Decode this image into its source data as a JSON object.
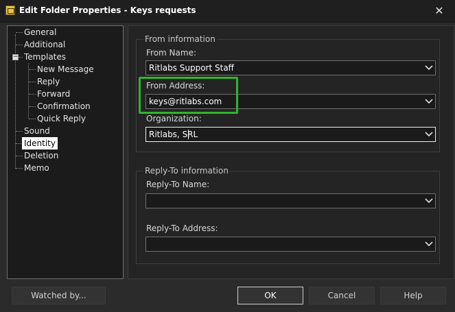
{
  "window": {
    "title": "Edit Folder Properties - Keys requests",
    "close_glyph": "✕"
  },
  "tree": {
    "items": [
      {
        "label": "General"
      },
      {
        "label": "Additional"
      },
      {
        "label": "Templates",
        "expanded": true
      },
      {
        "label": "New Message"
      },
      {
        "label": "Reply"
      },
      {
        "label": "Forward"
      },
      {
        "label": "Confirmation"
      },
      {
        "label": "Quick Reply"
      },
      {
        "label": "Sound"
      },
      {
        "label": "Identity",
        "selected": true
      },
      {
        "label": "Deletion"
      },
      {
        "label": "Memo"
      }
    ],
    "expander_glyph": "−"
  },
  "from_info": {
    "group_title": "From information",
    "from_name": {
      "label": "From Name:",
      "value": "Ritlabs Support Staff"
    },
    "from_address": {
      "label": "From Address:",
      "value": "keys@ritlabs.com"
    },
    "organization": {
      "label": "Organization:",
      "value": "Ritlabs, SRL"
    }
  },
  "reply_to": {
    "group_title": "Reply-To information",
    "reply_name": {
      "label": "Reply-To Name:",
      "value": ""
    },
    "reply_address": {
      "label": "Reply-To Address:",
      "value": ""
    }
  },
  "buttons": {
    "watched_by": "Watched by...",
    "ok": "OK",
    "cancel": "Cancel",
    "help": "Help"
  },
  "colors": {
    "highlight": "#2fb52f",
    "selection": "#ffffff"
  }
}
